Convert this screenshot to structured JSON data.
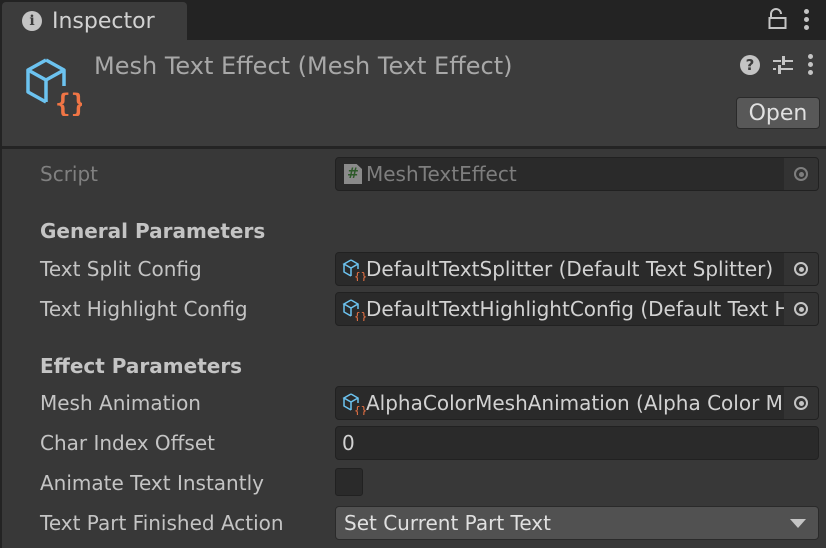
{
  "tab": {
    "label": "Inspector",
    "icon": "info-icon"
  },
  "tab_tools": {
    "lock_icon": "lock-open-icon",
    "menu_icon": "kebab-menu-icon"
  },
  "header": {
    "title": "Mesh Text Effect (Mesh Text Effect)",
    "icon": "scriptable-object-icon",
    "open_label": "Open",
    "help_icon": "help-icon",
    "presets_icon": "presets-sliders-icon",
    "menu_icon": "kebab-menu-icon"
  },
  "script": {
    "label": "Script",
    "value": "MeshTextEffect",
    "icon": "csharp-script-icon"
  },
  "sections": {
    "general": "General Parameters",
    "effect": "Effect Parameters"
  },
  "fields": {
    "text_split_config": {
      "label": "Text Split Config",
      "value": "DefaultTextSplitter (Default Text Splitter)"
    },
    "text_highlight_config": {
      "label": "Text Highlight Config",
      "value": "DefaultTextHighlightConfig (Default Text Highlight Config)"
    },
    "mesh_animation": {
      "label": "Mesh Animation",
      "value": "AlphaColorMeshAnimation (Alpha Color Mesh Animation)"
    },
    "char_index_offset": {
      "label": "Char Index Offset",
      "value": "0"
    },
    "animate_text_instantly": {
      "label": "Animate Text Instantly",
      "checked": false
    },
    "text_part_finished_action": {
      "label": "Text Part Finished Action",
      "value": "Set Current Part Text"
    }
  },
  "colors": {
    "panel_bg": "#383838",
    "header_bg": "#3c3c3c",
    "icon_blue": "#6cc3f0",
    "icon_orange": "#f07545"
  }
}
